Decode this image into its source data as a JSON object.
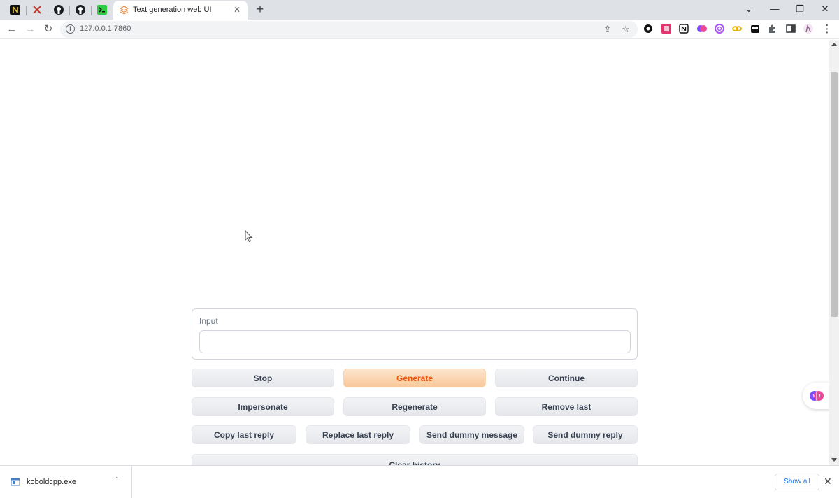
{
  "browser": {
    "pinned_tabs": [
      {
        "name": "notion-tab-icon"
      },
      {
        "name": "x-tab-icon"
      },
      {
        "name": "github-tab-icon"
      },
      {
        "name": "github-tab-icon-2"
      },
      {
        "name": "terminal-tab-icon"
      }
    ],
    "active_tab": {
      "title": "Text generation web UI",
      "close": "✕"
    },
    "new_tab": "+",
    "window_controls": {
      "dropdown": "⌄",
      "minimize": "—",
      "restore": "❐",
      "close": "✕"
    },
    "url": "127.0.0.1:7860",
    "nav": {
      "back": "←",
      "forward": "→",
      "reload": "↻"
    },
    "omnibox_icons": {
      "share": "⇪",
      "bookmark": "☆"
    },
    "menu": "⋮"
  },
  "main": {
    "input": {
      "label": "Input",
      "value": "",
      "placeholder": ""
    },
    "buttons_row1": [
      "Stop",
      "Generate",
      "Continue"
    ],
    "buttons_row2": [
      "Impersonate",
      "Regenerate",
      "Remove last"
    ],
    "buttons_row3": [
      "Copy last reply",
      "Replace last reply",
      "Send dummy message",
      "Send dummy reply"
    ],
    "clear_history": "Clear history"
  },
  "downloads": {
    "file_name": "koboldcpp.exe",
    "show_all": "Show all",
    "close": "✕",
    "chevron": "⌃"
  },
  "colors": {
    "accent": "#ea580c",
    "primary_button_bg": "#f8c89a",
    "button_bg": "#e5e7eb"
  }
}
